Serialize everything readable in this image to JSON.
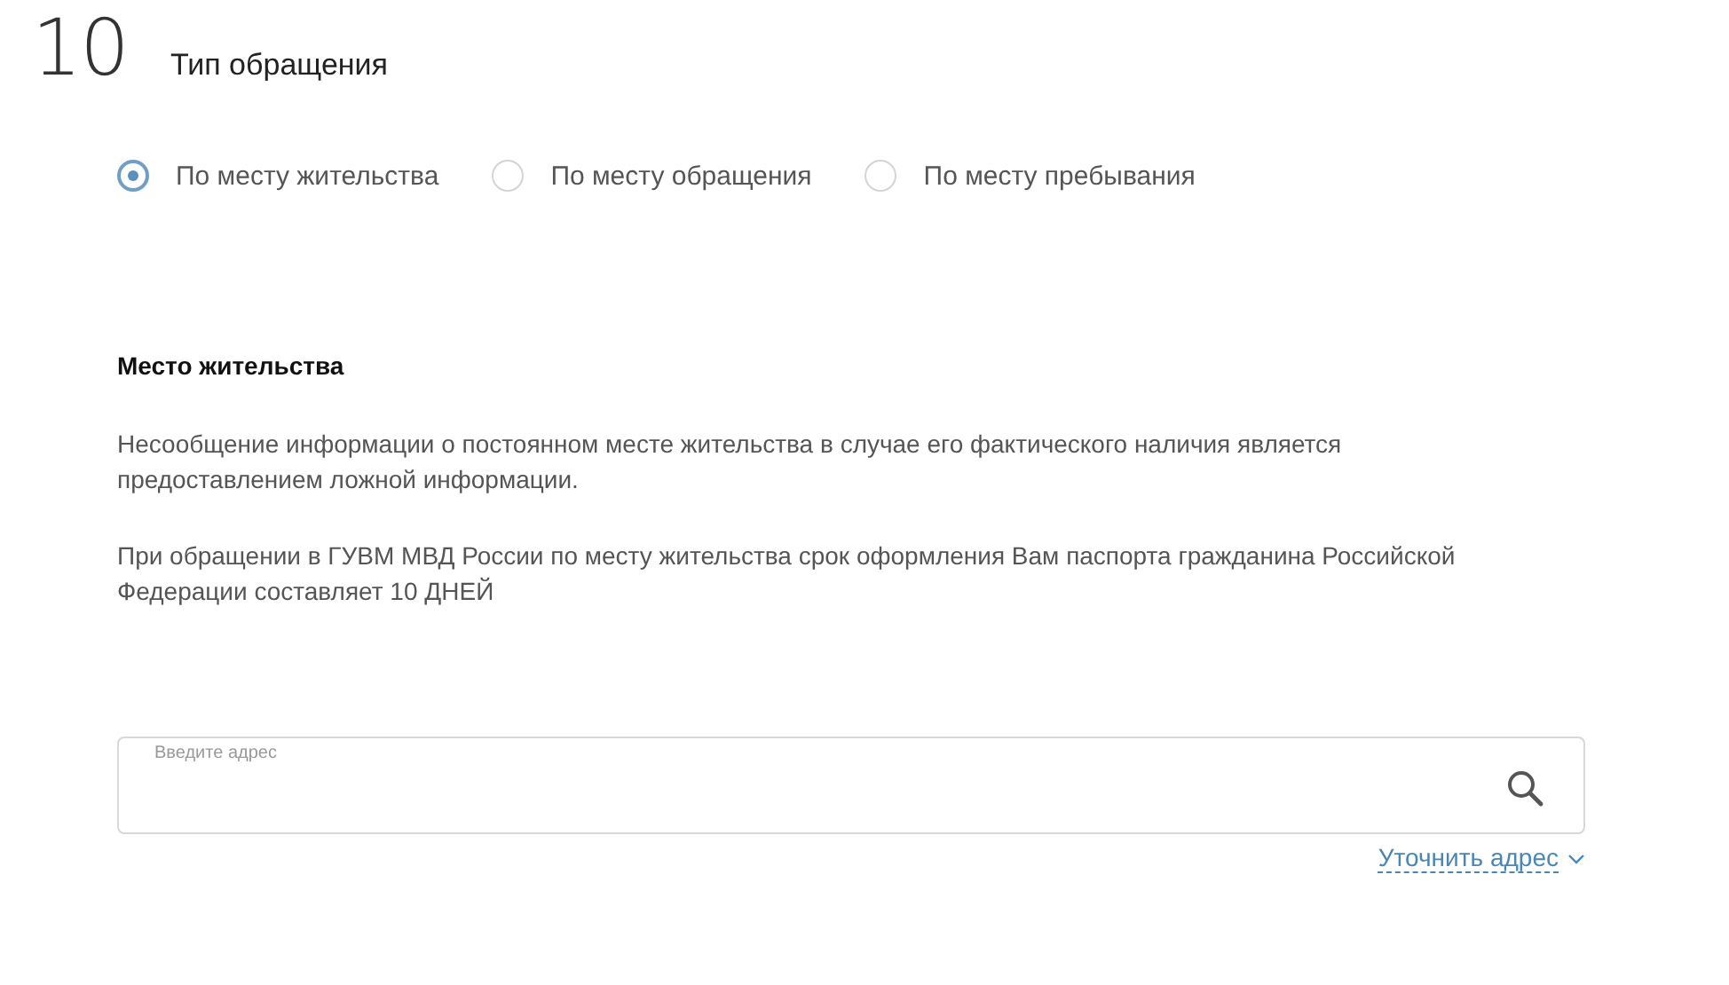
{
  "section": {
    "number": "10",
    "title": "Тип обращения"
  },
  "options": [
    {
      "label": "По месту жительства",
      "selected": true
    },
    {
      "label": "По месту обращения",
      "selected": false
    },
    {
      "label": "По месту пребывания",
      "selected": false
    }
  ],
  "info": {
    "heading": "Место жительства",
    "paragraphs": [
      "Несообщение информации о постоянном месте жительства в случае его фактического наличия является предоставлением ложной информации.",
      "При обращении в ГУВМ МВД России по месту жительства срок оформления Вам паспорта гражданина Российской Федерации составляет 10 ДНЕЙ"
    ]
  },
  "address": {
    "label": "Введите адрес",
    "link": "Уточнить адрес"
  }
}
